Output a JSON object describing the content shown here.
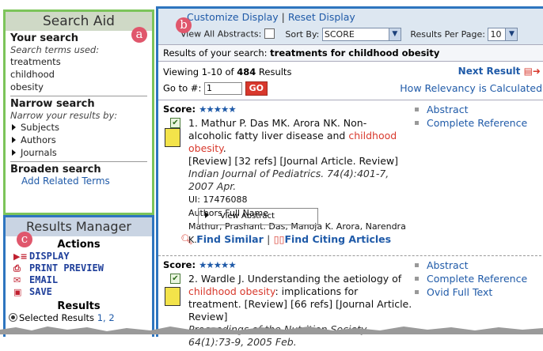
{
  "badges": {
    "a": "a",
    "b": "b",
    "c": "c"
  },
  "search_aid": {
    "title": "Search Aid",
    "your_search": "Your search",
    "terms_used_label": "Search terms used:",
    "terms": [
      "treatments",
      "childhood",
      "obesity"
    ],
    "narrow_title": "Narrow search",
    "narrow_sub": "Narrow your results by:",
    "narrow_items": [
      "Subjects",
      "Authors",
      "Journals"
    ],
    "broaden_title": "Broaden search",
    "add_related": "Add Related Terms"
  },
  "results_manager": {
    "title": "Results Manager",
    "actions_title": "Actions",
    "actions": [
      {
        "icon": "display-icon",
        "glyph": "▶≡",
        "label": "DISPLAY"
      },
      {
        "icon": "print-preview-icon",
        "glyph": "⎙",
        "label": "PRINT PREVIEW"
      },
      {
        "icon": "email-icon",
        "glyph": "✉",
        "label": "EMAIL"
      },
      {
        "icon": "save-icon",
        "glyph": "▣",
        "label": "SAVE"
      }
    ],
    "results_title": "Results",
    "selected_results_label": "Selected Results",
    "selected_results_values": "1, 2"
  },
  "toolbar": {
    "customize": "Customize Display",
    "separator": "|",
    "reset": "Reset Display",
    "view_all_abstracts": "View All Abstracts:",
    "sort_by_label": "Sort By:",
    "sort_by_value": "SCORE",
    "per_page_label": "Results Per Page:",
    "per_page_value": "10"
  },
  "summary": {
    "prefix": "Results of your search:",
    "query": "treatments for childhood obesity"
  },
  "viewing": {
    "prefix": "Viewing 1-10 of",
    "total": "484",
    "suffix": "Results",
    "next_result": "Next Result",
    "goto_label": "Go to #:",
    "goto_value": "1",
    "go_button": "GO",
    "relevancy_link": "How Relevancy is Calculated"
  },
  "results": [
    {
      "score_label": "Score:",
      "stars": "★★★★★",
      "checked": "✔",
      "number": "1.",
      "title_a": "Mathur P. Das MK. Arora NK. Non-",
      "title_b": "alcoholic fatty liver disease and",
      "title_highlight": "childhood obesity",
      "title_c": "[Review] [32 refs] [Journal Article. Review]",
      "citation": "Indian Journal of Pediatrics. 74(4):401-7, 2007 Apr.",
      "ui": "UI: 17476088",
      "authors_label": "Authors Full Name",
      "authors": "Mathur, Prashant. Das, Manoja K. Arora, Narendra K.",
      "view_abstract": "View Abstract",
      "find_similar": "Find Similar",
      "find_citing": "Find Citing Articles",
      "links": [
        "Abstract",
        "Complete Reference"
      ]
    },
    {
      "score_label": "Score:",
      "stars": "★★★★★",
      "checked": "✔",
      "number": "2.",
      "title_a": "Wardle J. Understanding the aetiology of",
      "title_highlight": "childhood obesity",
      "title_b": ": implications for",
      "title_c": "treatment. [Review] [66 refs] [Journal Article. Review]",
      "citation": "Proceedings of the Nutrition Society. 64(1):73-9, 2005 Feb.",
      "links": [
        "Abstract",
        "Complete Reference",
        "Ovid Full Text"
      ]
    }
  ],
  "colors": {
    "accent": "#2e75bf",
    "search_border": "#7cc45a",
    "highlight": "#d8382c"
  }
}
